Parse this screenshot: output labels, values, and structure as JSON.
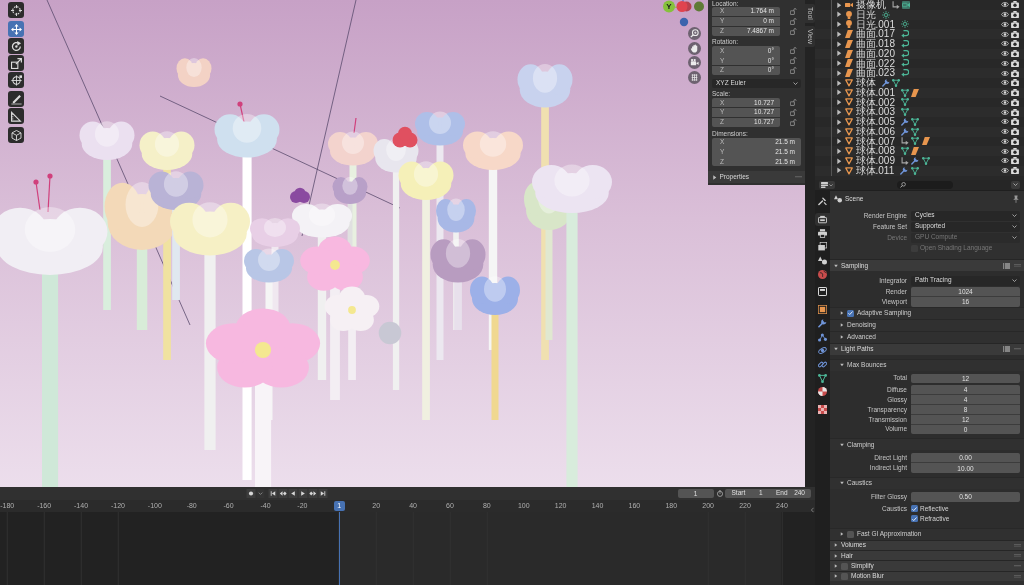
{
  "viewport": {
    "toolbar": [
      {
        "kind": "cursor",
        "selected": false
      },
      {
        "kind": "move",
        "selected": true
      },
      {
        "kind": "rotate",
        "selected": false
      },
      {
        "kind": "scale",
        "selected": false
      },
      {
        "kind": "transform",
        "selected": false
      },
      {
        "kind": "annotate",
        "selected": false
      },
      {
        "kind": "measure",
        "selected": false
      },
      {
        "kind": "add_cube",
        "selected": false
      }
    ],
    "gizmo": {
      "label": "Y"
    },
    "navigation": [
      {
        "kind": "zoom"
      },
      {
        "kind": "pan"
      },
      {
        "kind": "camera"
      },
      {
        "kind": "ortho"
      }
    ]
  },
  "sidebar": {
    "tabs": [
      {
        "label": "Tool",
        "selected": false
      },
      {
        "label": "View",
        "selected": false
      }
    ],
    "sections": [
      {
        "kind": "transform",
        "label": "Location:",
        "fields": [
          {
            "axis": "X",
            "value": "1.764 m",
            "locked": false
          },
          {
            "axis": "Y",
            "value": "0 m",
            "locked": false
          },
          {
            "axis": "Z",
            "value": "7.4867 m",
            "locked": false
          }
        ]
      },
      {
        "kind": "transform",
        "label": "Rotation:",
        "fields": [
          {
            "axis": "X",
            "value": "0°",
            "locked": false
          },
          {
            "axis": "Y",
            "value": "0°",
            "locked": false
          },
          {
            "axis": "Z",
            "value": "0°",
            "locked": false
          }
        ]
      },
      {
        "kind": "mode",
        "value": "XYZ Euler"
      },
      {
        "kind": "transform",
        "label": "Scale:",
        "fields": [
          {
            "axis": "X",
            "value": "10.727",
            "locked": false
          },
          {
            "axis": "Y",
            "value": "10.727",
            "locked": false
          },
          {
            "axis": "Z",
            "value": "10.727",
            "locked": false
          }
        ]
      },
      {
        "kind": "dimensions",
        "label": "Dimensions:",
        "fields": [
          {
            "axis": "X",
            "value": "21.5 m"
          },
          {
            "axis": "Y",
            "value": "21.5 m"
          },
          {
            "axis": "Z",
            "value": "21.5 m"
          }
        ]
      }
    ],
    "panel": {
      "title": "Properties",
      "expanded": false
    }
  },
  "outliner": {
    "items": [
      {
        "kind": "camera",
        "name": "摄像机",
        "expanded": false,
        "contents": [
          {
            "kind": "constraint",
            "active": false
          },
          {
            "kind": "camera_data",
            "active": true
          }
        ],
        "visible": true,
        "renderable": true
      },
      {
        "kind": "light",
        "name": "日光",
        "expanded": false,
        "contents": [
          {
            "kind": "light_data",
            "active": false
          }
        ],
        "visible": true,
        "renderable": true
      },
      {
        "kind": "light",
        "name": "日光.001",
        "expanded": false,
        "contents": [
          {
            "kind": "light_data",
            "active": false
          }
        ],
        "visible": true,
        "renderable": true
      },
      {
        "kind": "surface",
        "name": "曲面.017",
        "expanded": false,
        "contents": [
          {
            "kind": "surface_data",
            "active": false
          }
        ],
        "visible": true,
        "renderable": true
      },
      {
        "kind": "surface",
        "name": "曲面.018",
        "expanded": false,
        "contents": [
          {
            "kind": "surface_data",
            "active": false
          }
        ],
        "visible": true,
        "renderable": true
      },
      {
        "kind": "surface",
        "name": "曲面.020",
        "expanded": false,
        "contents": [
          {
            "kind": "surface_data",
            "active": false
          }
        ],
        "visible": true,
        "renderable": true
      },
      {
        "kind": "surface",
        "name": "曲面.022",
        "expanded": false,
        "contents": [
          {
            "kind": "surface_data",
            "active": false
          }
        ],
        "visible": true,
        "renderable": true
      },
      {
        "kind": "surface",
        "name": "曲面.023",
        "expanded": false,
        "contents": [
          {
            "kind": "surface_data",
            "active": false
          }
        ],
        "visible": true,
        "renderable": true
      },
      {
        "kind": "mesh",
        "name": "球体",
        "expanded": false,
        "contents": [
          {
            "kind": "modifier",
            "active": false
          },
          {
            "kind": "mesh_data",
            "active": false
          }
        ],
        "visible": true,
        "renderable": true
      },
      {
        "kind": "mesh",
        "name": "球体.001",
        "expanded": false,
        "contents": [
          {
            "kind": "mesh_data",
            "active": false
          },
          {
            "kind": "surface",
            "active": false
          }
        ],
        "visible": true,
        "renderable": true
      },
      {
        "kind": "mesh",
        "name": "球体.002",
        "expanded": false,
        "contents": [
          {
            "kind": "mesh_data",
            "active": false
          }
        ],
        "visible": true,
        "renderable": true
      },
      {
        "kind": "mesh",
        "name": "球体.003",
        "expanded": false,
        "contents": [
          {
            "kind": "mesh_data",
            "active": false
          }
        ],
        "visible": true,
        "renderable": true
      },
      {
        "kind": "mesh",
        "name": "球体.005",
        "expanded": false,
        "contents": [
          {
            "kind": "modifier",
            "active": false
          },
          {
            "kind": "mesh_data",
            "active": false
          }
        ],
        "visible": true,
        "renderable": true
      },
      {
        "kind": "mesh",
        "name": "球体.006",
        "expanded": false,
        "contents": [
          {
            "kind": "modifier",
            "active": false
          },
          {
            "kind": "mesh_data",
            "active": false
          }
        ],
        "visible": true,
        "renderable": true
      },
      {
        "kind": "mesh",
        "name": "球体.007",
        "expanded": false,
        "contents": [
          {
            "kind": "constraint",
            "active": false
          },
          {
            "kind": "mesh_data",
            "active": false
          },
          {
            "kind": "surface",
            "active": false
          }
        ],
        "visible": true,
        "renderable": true
      },
      {
        "kind": "mesh",
        "name": "球体.008",
        "expanded": false,
        "contents": [
          {
            "kind": "mesh_data",
            "active": false
          },
          {
            "kind": "surface",
            "active": false
          }
        ],
        "visible": true,
        "renderable": true
      },
      {
        "kind": "mesh",
        "name": "球体.009",
        "expanded": false,
        "contents": [
          {
            "kind": "constraint",
            "active": false
          },
          {
            "kind": "modifier",
            "active": false
          },
          {
            "kind": "mesh_data",
            "active": false
          }
        ],
        "visible": true,
        "renderable": true
      },
      {
        "kind": "mesh",
        "name": "球体.011",
        "expanded": false,
        "contents": [
          {
            "kind": "modifier",
            "active": false
          },
          {
            "kind": "mesh_data",
            "active": false
          }
        ],
        "visible": true,
        "renderable": true
      }
    ]
  },
  "properties": {
    "tabs": [
      {
        "kind": "tool",
        "selected": false
      },
      {
        "kind": "render",
        "selected": true
      },
      {
        "kind": "output",
        "selected": false
      },
      {
        "kind": "view_layer",
        "selected": false
      },
      {
        "kind": "scene",
        "selected": false
      },
      {
        "kind": "world",
        "selected": false
      },
      {
        "kind": "collection",
        "selected": false
      },
      {
        "kind": "object",
        "selected": false
      },
      {
        "kind": "modifiers",
        "selected": false
      },
      {
        "kind": "particles",
        "selected": false
      },
      {
        "kind": "physics",
        "selected": false
      },
      {
        "kind": "constraints",
        "selected": false
      },
      {
        "kind": "data",
        "selected": false
      },
      {
        "kind": "material",
        "selected": false
      },
      {
        "kind": "texture",
        "selected": false
      }
    ],
    "context": "Scene",
    "rows": [
      {
        "kind": "dropdown",
        "label": "Render Engine",
        "value": "Cycles",
        "disabled": false
      },
      {
        "kind": "dropdown",
        "label": "Feature Set",
        "value": "Supported",
        "disabled": false
      },
      {
        "kind": "dropdown",
        "label": "Device",
        "value": "GPU Compute",
        "disabled": true
      },
      {
        "kind": "checkbox",
        "label": "Open Shading Language",
        "checked": false,
        "disabled": true
      }
    ],
    "panels": [
      {
        "kind": "panel",
        "title": "Sampling",
        "expanded": true,
        "presets": true,
        "rows": [
          {
            "kind": "dropdown",
            "label": "Integrator",
            "value": "Path Tracing",
            "disabled": false
          },
          {
            "kind": "numbers",
            "items": [
              {
                "label": "Render",
                "value": "1024"
              },
              {
                "label": "Viewport",
                "value": "16"
              }
            ]
          },
          {
            "kind": "toggle_subpanel",
            "title": "Adaptive Sampling",
            "expanded": false,
            "checked": true
          },
          {
            "kind": "subpanel",
            "title": "Denoising",
            "expanded": false
          },
          {
            "kind": "subpanel",
            "title": "Advanced",
            "expanded": false
          }
        ]
      },
      {
        "kind": "panel",
        "title": "Light Paths",
        "expanded": true,
        "presets": true,
        "rows": [
          {
            "kind": "subpanel",
            "title": "Max Bounces",
            "expanded": true,
            "rows": [
              {
                "kind": "numbers",
                "items": [
                  {
                    "label": "Total",
                    "value": "12"
                  }
                ]
              },
              {
                "kind": "numbers",
                "items": [
                  {
                    "label": "Diffuse",
                    "value": "4"
                  },
                  {
                    "label": "Glossy",
                    "value": "4"
                  },
                  {
                    "label": "Transparency",
                    "value": "8"
                  },
                  {
                    "label": "Transmission",
                    "value": "12"
                  },
                  {
                    "label": "Volume",
                    "value": "0"
                  }
                ]
              }
            ]
          },
          {
            "kind": "subpanel",
            "title": "Clamping",
            "expanded": true,
            "rows": [
              {
                "kind": "numbers",
                "items": [
                  {
                    "label": "Direct Light",
                    "value": "0.00"
                  },
                  {
                    "label": "Indirect Light",
                    "value": "10.00"
                  }
                ]
              }
            ]
          },
          {
            "kind": "subpanel",
            "title": "Caustics",
            "expanded": true,
            "rows": [
              {
                "kind": "numbers",
                "items": [
                  {
                    "label": "Filter Glossy",
                    "value": "0.50"
                  }
                ]
              },
              {
                "kind": "checkboxes",
                "label": "Caustics",
                "items": [
                  {
                    "label": "Reflective",
                    "checked": true
                  },
                  {
                    "label": "Refractive",
                    "checked": true
                  }
                ]
              }
            ]
          },
          {
            "kind": "toggle_subpanel",
            "title": "Fast GI Approximation",
            "expanded": false,
            "checked": false
          }
        ]
      },
      {
        "kind": "panel",
        "title": "Volumes",
        "expanded": false,
        "presets": false
      },
      {
        "kind": "panel",
        "title": "Hair",
        "expanded": false,
        "presets": false
      },
      {
        "kind": "toggle_panel",
        "title": "Simplify",
        "expanded": false,
        "presets": false,
        "checked": false
      },
      {
        "kind": "toggle_panel",
        "title": "Motion Blur",
        "expanded": false,
        "presets": false,
        "checked": false
      }
    ]
  },
  "timeline": {
    "transport": [
      {
        "kind": "record"
      },
      {
        "kind": "keying_menu"
      },
      {
        "kind": "jump_start"
      },
      {
        "kind": "prev_key"
      },
      {
        "kind": "play_reverse"
      },
      {
        "kind": "play"
      },
      {
        "kind": "next_key"
      },
      {
        "kind": "jump_end"
      }
    ],
    "current_frame": "1",
    "start": {
      "label": "Start",
      "value": "1"
    },
    "end": {
      "label": "End",
      "value": "240"
    },
    "ruler": {
      "before": [
        "-180",
        "-160",
        "-140",
        "-120",
        "-100",
        "-80",
        "-60",
        "-40",
        "-20"
      ],
      "current": "1",
      "after": [
        "20",
        "40",
        "60",
        "80",
        "100",
        "120",
        "140",
        "160",
        "180",
        "200",
        "220",
        "240"
      ]
    }
  }
}
